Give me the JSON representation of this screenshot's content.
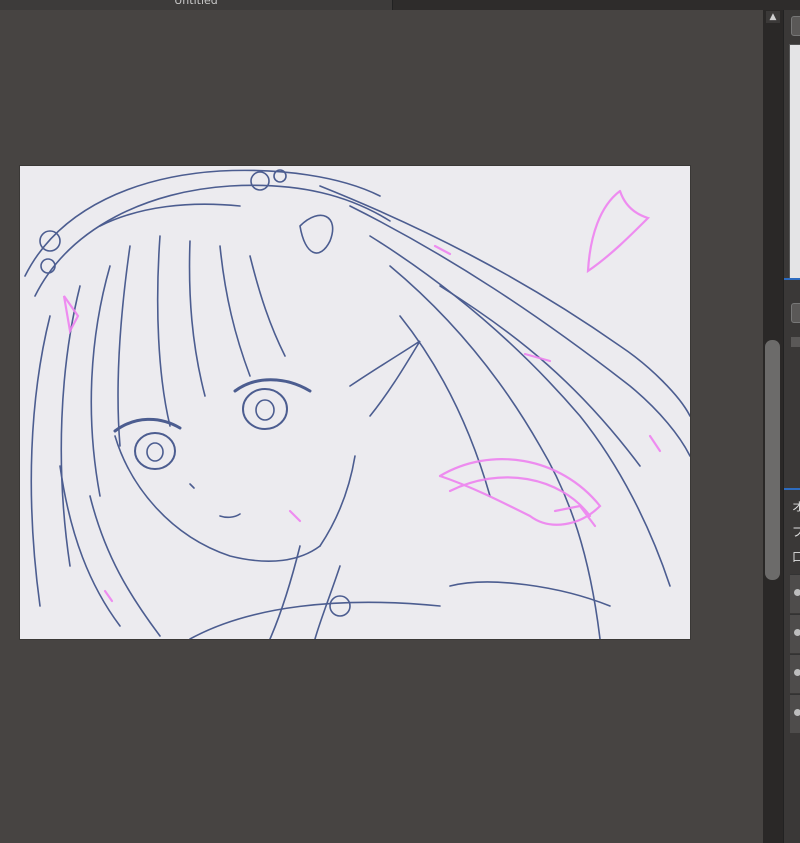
{
  "document": {
    "tab_title": "Untitled"
  },
  "scroll": {
    "up_glyph": "▲"
  },
  "panel": {
    "labels": [
      "オ",
      "ブ",
      "口"
    ],
    "layer_rows": 4
  },
  "colors": {
    "sketch_blue": "#3b4e86",
    "sketch_pink": "#ee82f0",
    "canvas_bg": "#ecebef",
    "workspace_bg": "#474442",
    "accent": "#2d6cc0"
  }
}
